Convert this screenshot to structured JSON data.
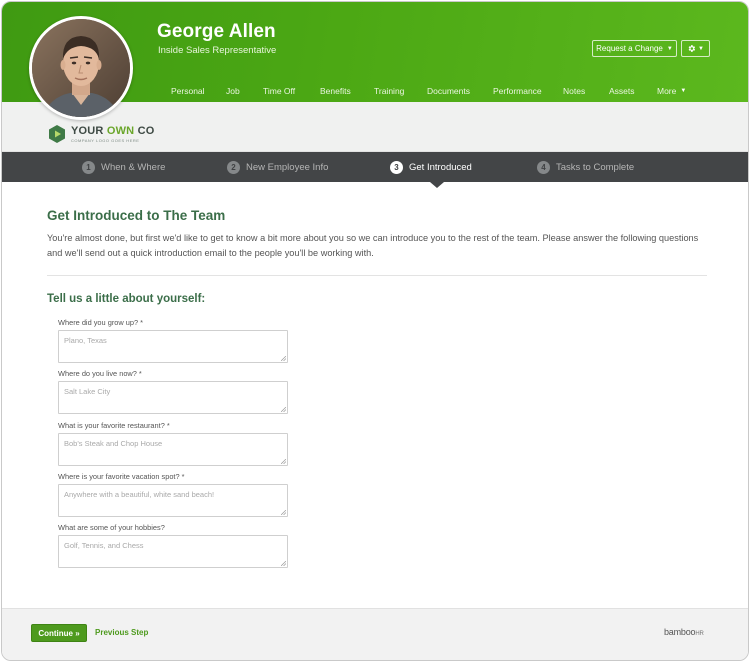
{
  "employee": {
    "name": "George Allen",
    "title": "Inside Sales Representative"
  },
  "actions": {
    "request_change": "Request a Change",
    "gear_icon": "gear-icon"
  },
  "nav": {
    "items": [
      "Personal",
      "Job",
      "Time Off",
      "Benefits",
      "Training",
      "Documents",
      "Performance",
      "Notes",
      "Assets"
    ],
    "more": "More"
  },
  "company": {
    "name_part1": "YOUR ",
    "name_part2": "OWN",
    "name_part3": " CO",
    "tagline": "COMPANY LOGO GOES HERE"
  },
  "steps": [
    {
      "num": "1",
      "label": "When & Where"
    },
    {
      "num": "2",
      "label": "New Employee Info"
    },
    {
      "num": "3",
      "label": "Get Introduced"
    },
    {
      "num": "4",
      "label": "Tasks to Complete"
    }
  ],
  "active_step": 3,
  "content": {
    "title": "Get Introduced to The Team",
    "intro_line1": "You're almost done, but first we'd like to get to know a bit more about you so we can introduce you to the rest of the team. Please answer the following questions",
    "intro_line2": "and we'll send out a quick introduction email to the people you'll be working with.",
    "section_title": "Tell us a little about yourself:"
  },
  "fields": [
    {
      "label": "Where did you grow up? *",
      "placeholder": "Plano, Texas"
    },
    {
      "label": "Where do you live now? *",
      "placeholder": "Salt Lake City"
    },
    {
      "label": "What is your favorite restaurant? *",
      "placeholder": "Bob's Steak and Chop House"
    },
    {
      "label": "Where is your favorite vacation spot? *",
      "placeholder": "Anywhere with a beautiful, white sand beach!"
    },
    {
      "label": "What are some of your hobbies?",
      "placeholder": "Golf, Tennis, and Chess"
    }
  ],
  "footer": {
    "continue": "Continue »",
    "previous": "Previous Step",
    "brand_main": "bamboo",
    "brand_suffix": "HR"
  },
  "colors": {
    "header_green": "#4ca814",
    "accent_green": "#3b6e49",
    "button_green": "#4e9a1e",
    "steps_bar": "#434547"
  }
}
